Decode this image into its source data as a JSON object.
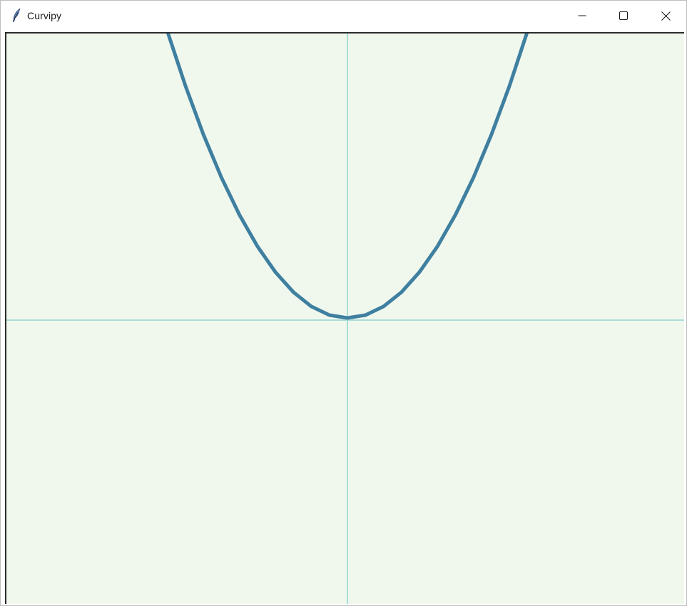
{
  "window": {
    "title": "Curvipy",
    "icons": {
      "app": "feather-icon",
      "minimize": "minimize-icon",
      "maximize": "maximize-icon",
      "close": "close-icon"
    }
  },
  "canvas": {
    "background": "#f0f8ee",
    "axis_color": "#a8ddd8",
    "curve_color": "#3f7fa0"
  },
  "chart_data": {
    "type": "line",
    "x": [
      -5,
      -4.5,
      -4,
      -3.5,
      -3,
      -2.5,
      -2,
      -1.5,
      -1,
      -0.5,
      0,
      0.5,
      1,
      1.5,
      2,
      2.5,
      3,
      3.5,
      4,
      4.5,
      5
    ],
    "y": [
      25,
      20.25,
      16,
      12.25,
      9,
      6.25,
      4,
      2.25,
      1,
      0.25,
      0,
      0.25,
      1,
      2.25,
      4,
      6.25,
      9,
      12.25,
      16,
      20.25,
      25
    ],
    "grid": false,
    "axes_visible": true
  }
}
